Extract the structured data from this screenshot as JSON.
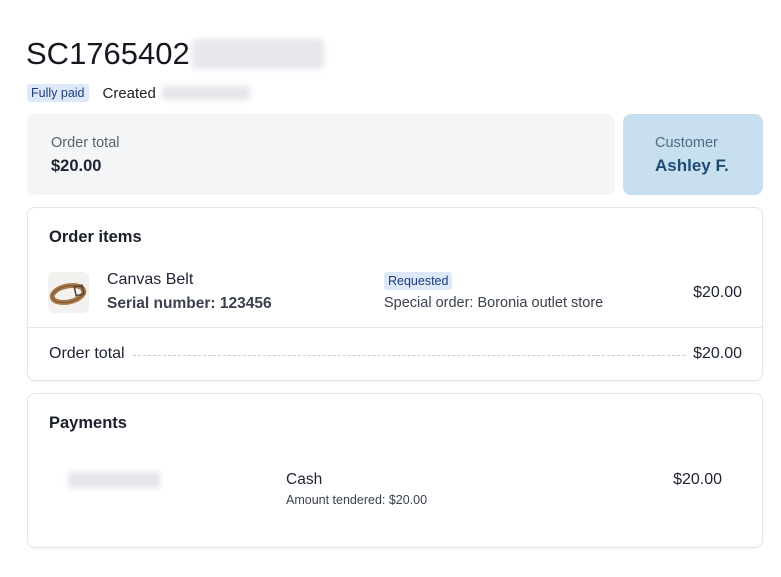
{
  "order": {
    "id_prefix": "SC1765402",
    "payment_status": "Fully paid",
    "created_label": "Created"
  },
  "summary": {
    "total_label": "Order total",
    "total_value": "$20.00",
    "customer_label": "Customer",
    "customer_name": "Ashley F."
  },
  "items_panel": {
    "title": "Order items",
    "items": [
      {
        "name": "Canvas Belt",
        "serial": "Serial number: 123456",
        "status": "Requested",
        "note": "Special order: Boronia outlet store",
        "price": "$20.00",
        "thumbnail_icon": "belt-image"
      }
    ],
    "total_label": "Order total",
    "total_value": "$20.00"
  },
  "payments_panel": {
    "title": "Payments",
    "payments": [
      {
        "method": "Cash",
        "tendered": "Amount tendered: $20.00",
        "amount": "$20.00"
      }
    ]
  },
  "colors": {
    "badge_bg": "#dde8fb",
    "badge_text": "#1f3c7a",
    "customer_card_bg": "#c8dff0",
    "customer_text": "#1f4a72",
    "summary_card_bg": "#f4f5f7"
  }
}
